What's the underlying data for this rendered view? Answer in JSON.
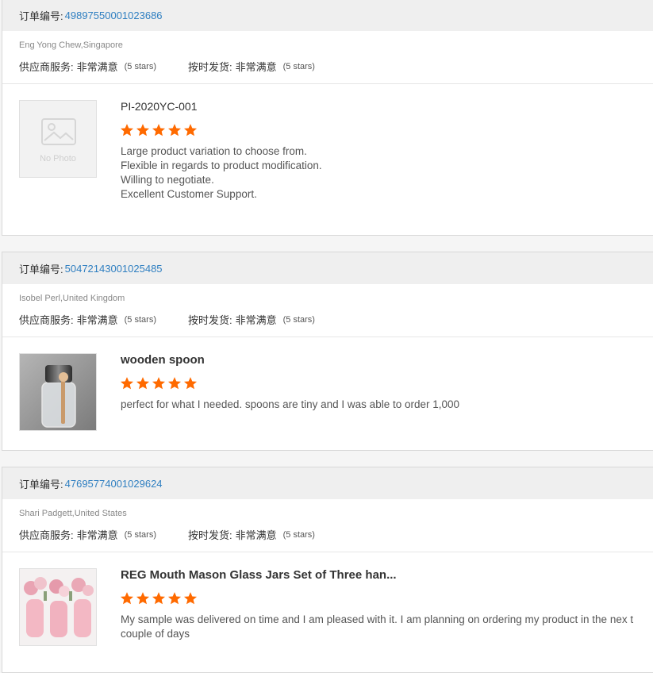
{
  "labels": {
    "order_number": "订单编号:",
    "supplier_service": "供应商服务:",
    "on_time_delivery": "按时发货:",
    "no_photo": "No Photo"
  },
  "star_color": "#ff6a00",
  "reviews": [
    {
      "order_number": "4989755000102368 6",
      "order_number_display": "4989755000102368 6",
      "buyer": "Eng Yong Chew,Singapore",
      "supplier_rating": "非常满意",
      "supplier_stars": "(5 stars)",
      "delivery_rating": "非常满意",
      "delivery_stars": "(5 stars)",
      "product_title": "PI-2020YC-001",
      "thumbnail": "no-photo",
      "rating": 5,
      "review_lines": [
        "Large product variation to choose from.",
        "Flexible in regards to product modification.",
        "Willing to negotiate.",
        "Excellent Customer Support."
      ]
    },
    {
      "order_number": "50472143001025485",
      "buyer": "Isobel Perl,United Kingdom",
      "supplier_rating": "非常满意",
      "supplier_stars": "(5 stars)",
      "delivery_rating": "非常满意",
      "delivery_stars": "(5 stars)",
      "product_title": "wooden spoon",
      "thumbnail": "glass-jar-with-wooden-spoon",
      "rating": 5,
      "review_lines": [
        "perfect for what I needed. spoons are tiny and I was able to order 1,000"
      ]
    },
    {
      "order_number": "47695774001029624",
      "buyer": "Shari Padgett,United States",
      "supplier_rating": "非常满意",
      "supplier_stars": "(5 stars)",
      "delivery_rating": "非常满意",
      "delivery_stars": "(5 stars)",
      "product_title": "REG Mouth Mason Glass Jars Set of Three han...",
      "thumbnail": "pink-mason-jars-with-flowers",
      "rating": 5,
      "review_lines": [
        "My sample was delivered on time and I am pleased with it.  I am planning on ordering my product in the nex t couple of days"
      ]
    }
  ]
}
